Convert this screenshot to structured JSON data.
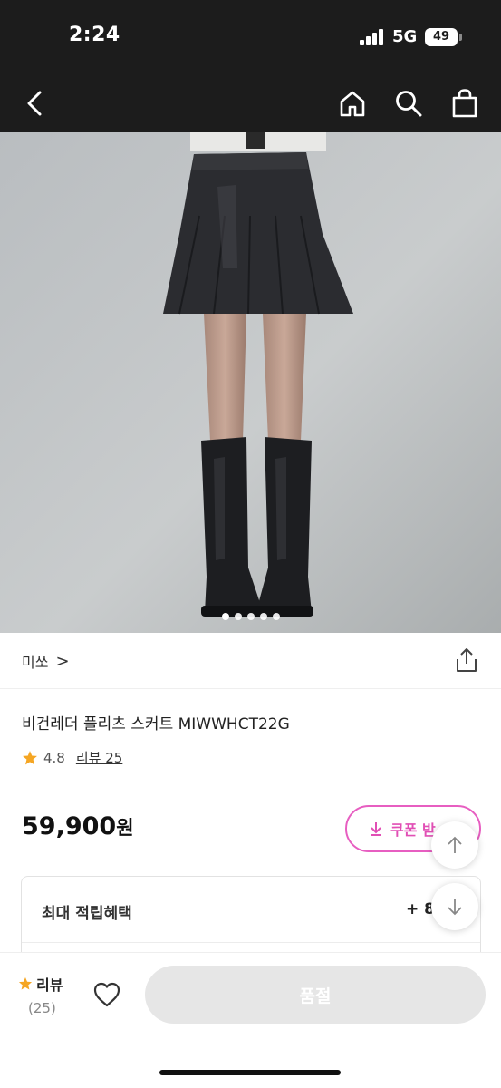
{
  "status_bar": {
    "time": "2:24",
    "network": "5G",
    "battery": "49"
  },
  "nav": {
    "back_icon": "chevron-left-icon",
    "home_icon": "home-icon",
    "search_icon": "search-icon",
    "cart_icon": "shopping-bag-icon"
  },
  "gallery": {
    "image_count": 5,
    "active_index": 0
  },
  "brand": {
    "name": "미쏘",
    "chevron": ">"
  },
  "product": {
    "name": "비건레더 플리츠 스커트 MIWWHCT22G"
  },
  "rating": {
    "value": "4.8",
    "review_link": "리뷰 25"
  },
  "price": {
    "amount": "59,900",
    "unit": "원"
  },
  "coupon": {
    "label": "쿠폰 받"
  },
  "benefit": {
    "label": "최대 적립혜택",
    "value": "+ 8"
  },
  "bottom": {
    "review_label": "리뷰",
    "review_count": "(25)",
    "buy_label": "품절"
  },
  "colors": {
    "accent": "#e14fb5",
    "star": "#f5a623",
    "dark_bar": "#1c1c1c",
    "disabled_button": "#e6e6e6"
  }
}
